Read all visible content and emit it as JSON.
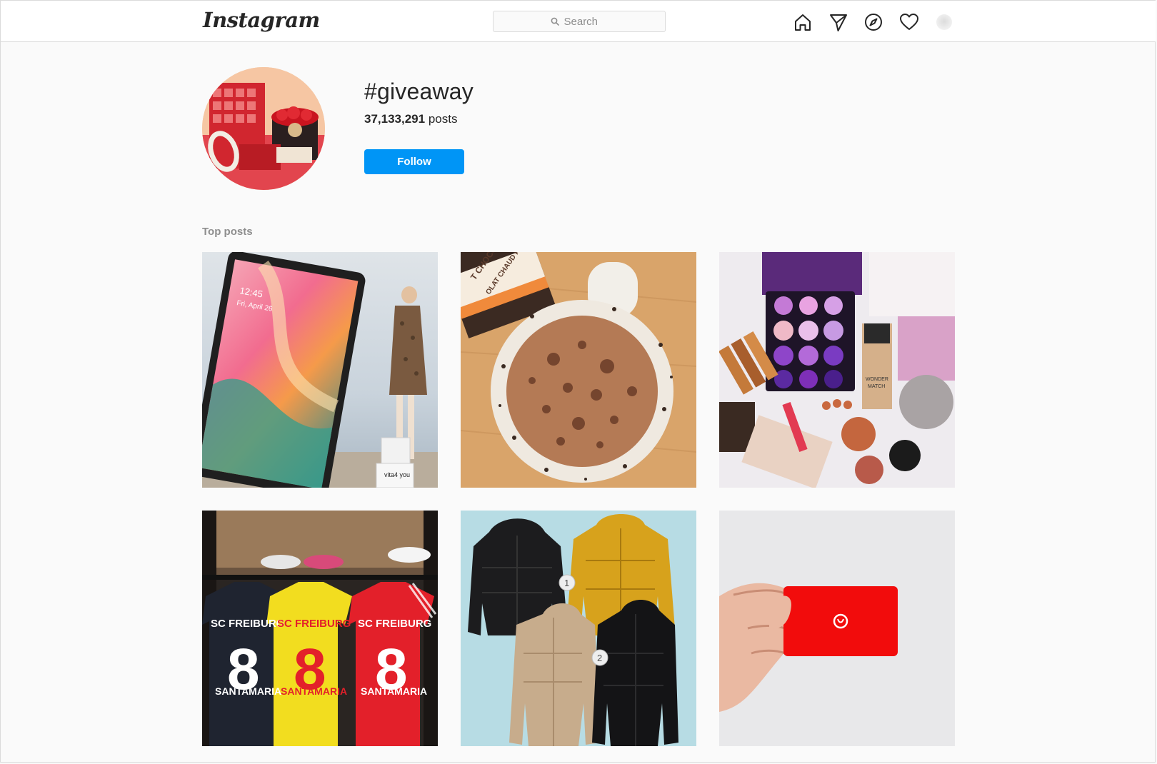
{
  "header": {
    "logo_text": "Instagram",
    "search_placeholder": "Search",
    "nav_icons": [
      "home-icon",
      "direct-icon",
      "explore-icon",
      "activity-icon",
      "profile-avatar"
    ]
  },
  "hashtag": {
    "title": "#giveaway",
    "post_count": "37,133,291",
    "post_label": " posts",
    "follow_label": "Follow"
  },
  "section": {
    "top_posts_label": "Top posts"
  },
  "posts": [
    {
      "id": "tablet",
      "text_lines": [
        "12:45",
        "Fri, April 26"
      ],
      "box_label": "vita4 you"
    },
    {
      "id": "hot-chocolate",
      "text_lines": [
        "T CHOCOLATE",
        "OLAT CHAUD RÉCON"
      ]
    },
    {
      "id": "makeup",
      "text_lines": [
        "WONDER",
        "MATCH"
      ]
    },
    {
      "id": "jerseys",
      "text_lines": [
        "SC FREIBURG",
        "8",
        "SANTAMARIA"
      ]
    },
    {
      "id": "jackets",
      "badges": [
        "1",
        "2"
      ]
    },
    {
      "id": "gift-card"
    }
  ],
  "colors": {
    "accent": "#0095f6",
    "border": "#dbdbdb",
    "muted_text": "#8e8e8e",
    "background": "#fafafa"
  }
}
